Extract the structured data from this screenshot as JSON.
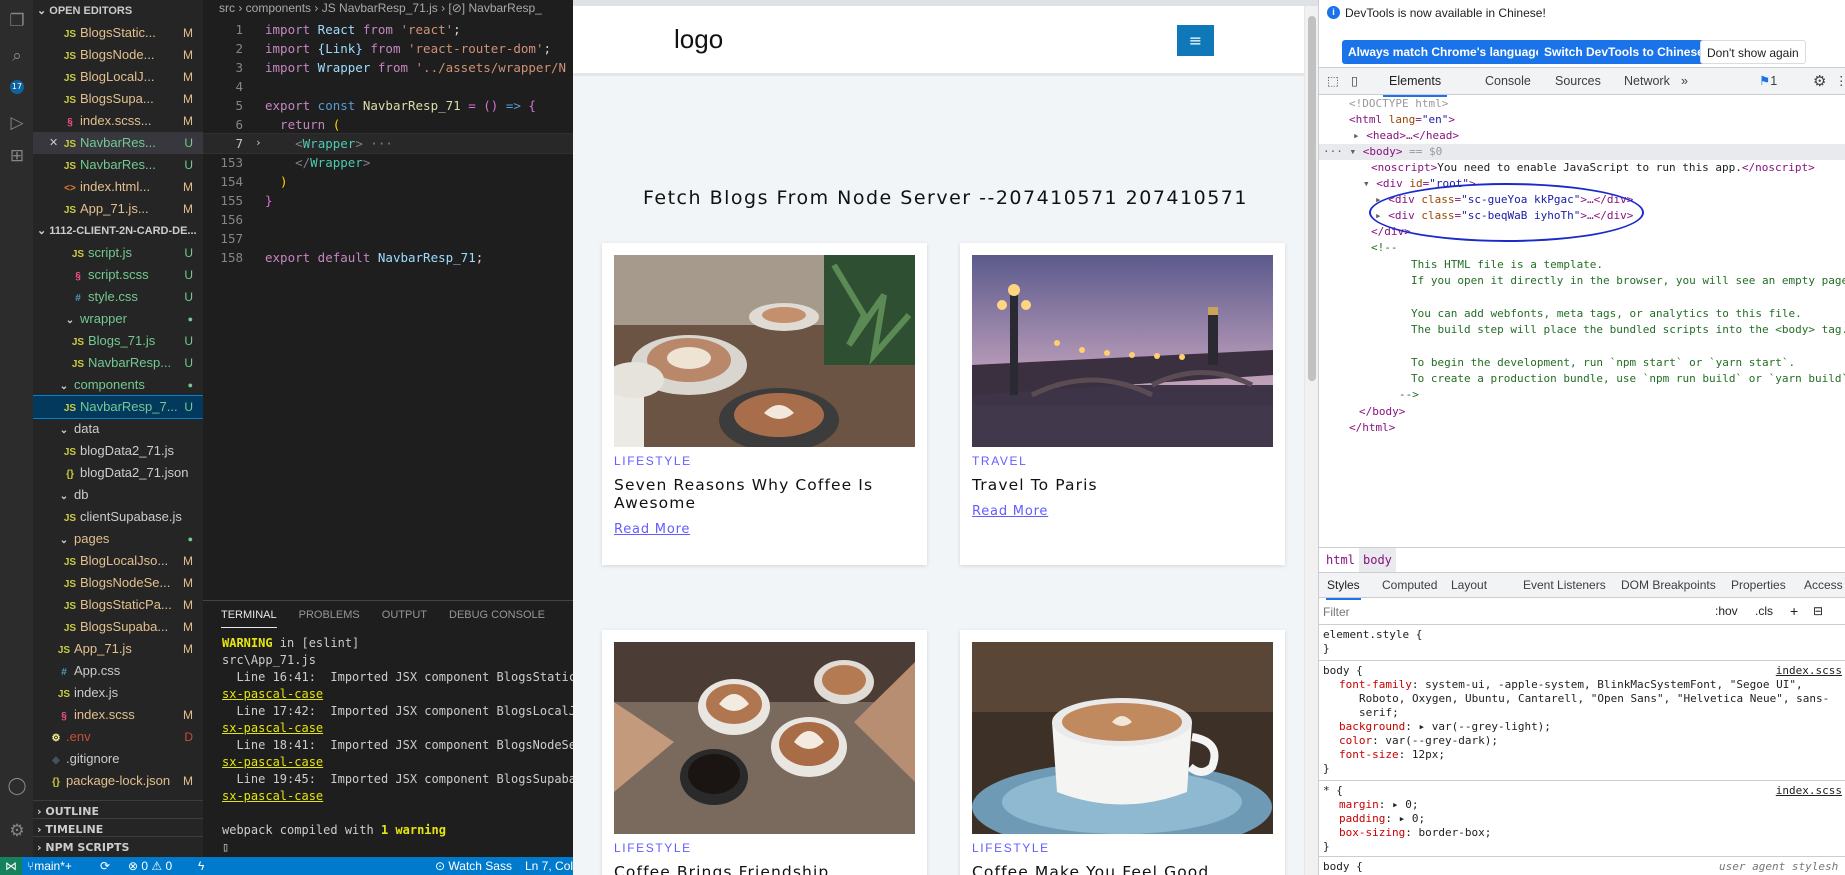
{
  "vscode": {
    "scm_badge": "17",
    "sidebar": {
      "open_editors_header": "OPEN EDITORS",
      "open_editors": [
        {
          "icon": "JS",
          "name": "BlogsStatic...",
          "status": "M",
          "kind": "js"
        },
        {
          "icon": "JS",
          "name": "BlogsNode...",
          "status": "M",
          "kind": "js"
        },
        {
          "icon": "JS",
          "name": "BlogLocalJ...",
          "status": "M",
          "kind": "js"
        },
        {
          "icon": "JS",
          "name": "BlogsSupa...",
          "status": "M",
          "kind": "js"
        },
        {
          "icon": "§",
          "name": "index.scss...",
          "status": "M",
          "kind": "scss"
        },
        {
          "icon": "JS",
          "name": "NavbarRes...",
          "status": "U",
          "kind": "js"
        },
        {
          "icon": "JS",
          "name": "NavbarRes...",
          "status": "U",
          "kind": "js"
        },
        {
          "icon": "<>",
          "name": "index.html...",
          "status": "M",
          "kind": "html"
        },
        {
          "icon": "JS",
          "name": "App_71.js...",
          "status": "M",
          "kind": "js"
        }
      ],
      "project_header": "1112-CLIENT-2N-CARD-DE...",
      "tree": [
        {
          "indent": 30,
          "icon": "JS",
          "name": "script.js",
          "status": "U",
          "kind": "js"
        },
        {
          "indent": 30,
          "icon": "§",
          "name": "script.scss",
          "status": "U",
          "kind": "scss"
        },
        {
          "indent": 30,
          "icon": "#",
          "name": "style.css",
          "status": "U",
          "kind": "css"
        },
        {
          "indent": 22,
          "icon": "⌄",
          "name": "wrapper",
          "status": "●",
          "kind": "folder"
        },
        {
          "indent": 30,
          "icon": "JS",
          "name": "Blogs_71.js",
          "status": "U",
          "kind": "js"
        },
        {
          "indent": 30,
          "icon": "JS",
          "name": "NavbarResp...",
          "status": "U",
          "kind": "js"
        },
        {
          "indent": 16,
          "icon": "⌄",
          "name": "components",
          "status": "●",
          "kind": "folder"
        },
        {
          "indent": 22,
          "icon": "JS",
          "name": "NavbarResp_7...",
          "status": "U",
          "kind": "js",
          "selected": true
        },
        {
          "indent": 16,
          "icon": "⌄",
          "name": "data",
          "status": "",
          "kind": "folder-plain"
        },
        {
          "indent": 22,
          "icon": "JS",
          "name": "blogData2_71.js",
          "status": "",
          "kind": "js-plain"
        },
        {
          "indent": 22,
          "icon": "{}",
          "name": "blogData2_71.json",
          "status": "",
          "kind": "json-plain"
        },
        {
          "indent": 16,
          "icon": "⌄",
          "name": "db",
          "status": "",
          "kind": "folder-plain"
        },
        {
          "indent": 22,
          "icon": "JS",
          "name": "clientSupabase.js",
          "status": "",
          "kind": "js-plain"
        },
        {
          "indent": 16,
          "icon": "⌄",
          "name": "pages",
          "status": "●",
          "kind": "folder-m"
        },
        {
          "indent": 22,
          "icon": "JS",
          "name": "BlogLocalJso...",
          "status": "M",
          "kind": "js"
        },
        {
          "indent": 22,
          "icon": "JS",
          "name": "BlogsNodeSe...",
          "status": "M",
          "kind": "js"
        },
        {
          "indent": 22,
          "icon": "JS",
          "name": "BlogsStaticPa...",
          "status": "M",
          "kind": "js"
        },
        {
          "indent": 22,
          "icon": "JS",
          "name": "BlogsSupaba...",
          "status": "M",
          "kind": "js"
        },
        {
          "indent": 16,
          "icon": "JS",
          "name": "App_71.js",
          "status": "M",
          "kind": "js"
        },
        {
          "indent": 16,
          "icon": "#",
          "name": "App.css",
          "status": "",
          "kind": "css-plain"
        },
        {
          "indent": 16,
          "icon": "JS",
          "name": "index.js",
          "status": "",
          "kind": "js-plain"
        },
        {
          "indent": 16,
          "icon": "§",
          "name": "index.scss",
          "status": "M",
          "kind": "scss"
        },
        {
          "indent": 8,
          "icon": "⚙",
          "name": ".env",
          "status": "D",
          "kind": "env"
        },
        {
          "indent": 8,
          "icon": "◆",
          "name": ".gitignore",
          "status": "",
          "kind": "git"
        },
        {
          "indent": 8,
          "icon": "{}",
          "name": "package-lock.json",
          "status": "M",
          "kind": "json"
        }
      ],
      "outline_header": "OUTLINE",
      "timeline_header": "TIMELINE",
      "npm_header": "NPM SCRIPTS"
    },
    "breadcrumb": "src  ›  components  ›   JS  NavbarResp_71.js  ›  [⊘] NavbarResp_",
    "code": [
      {
        "n": "1"
      },
      {
        "n": "2"
      },
      {
        "n": "3"
      },
      {
        "n": "4"
      },
      {
        "n": "5"
      },
      {
        "n": "6"
      },
      {
        "n": "7"
      },
      {
        "n": "153"
      },
      {
        "n": "154"
      },
      {
        "n": "155"
      },
      {
        "n": "156"
      },
      {
        "n": "157"
      },
      {
        "n": "158"
      }
    ],
    "code_text": {
      "l1_a": "import",
      "l1_b": " React ",
      "l1_c": "from",
      "l1_d": " 'react'",
      "l1_e": ";",
      "l2_a": "import",
      "l2_b": " {Link} ",
      "l2_c": "from",
      "l2_d": " 'react-router-dom'",
      "l2_e": ";",
      "l3_a": "import",
      "l3_b": " Wrapper ",
      "l3_c": "from",
      "l3_d": " '../assets/wrapper/N",
      "l5_a": "export",
      "l5_b": " const ",
      "l5_c": "NavbarResp_71",
      "l5_d": " = () ",
      "l5_e": "=>",
      "l5_f": " {",
      "l6_a": "  return",
      "l6_b": " (",
      "l7_a": "    <",
      "l7_b": "Wrapper",
      "l7_c": ">",
      "l7_d": " ···",
      "l153_a": "    </",
      "l153_b": "Wrapper",
      "l153_c": ">",
      "l154": "  )",
      "l155": "}",
      "l157_a": "export",
      "l157_b": " default",
      "l157_c": " NavbarResp_71",
      "l157_d": ";"
    },
    "terminal": {
      "tabs": [
        "TERMINAL",
        "PROBLEMS",
        "OUTPUT",
        "DEBUG CONSOLE"
      ],
      "warning_word": "WARNING",
      "warning_rest": " in [eslint]",
      "file": "src\\App_71.js",
      "lines": [
        {
          "pos": "  Line 16:41:",
          "msg": "  Imported JSX component BlogsStaticP"
        },
        {
          "pos": "  Line 17:42:",
          "msg": "  Imported JSX component BlogsLocalJs"
        },
        {
          "pos": "  Line 18:41:",
          "msg": "  Imported JSX component BlogsNodeSer"
        },
        {
          "pos": "  Line 19:45:",
          "msg": "  Imported JSX component BlogsSupabas"
        }
      ],
      "rule": "sx-pascal-case",
      "compiled_a": "webpack compiled with ",
      "compiled_b": "1 warning"
    },
    "status": {
      "branch": "main*+",
      "sync": "⟳",
      "problems": "⊗ 0 ⚠ 0",
      "bolt": "ϟ",
      "watch": "⊙ Watch Sass",
      "pos": "Ln 7, Col"
    }
  },
  "browser": {
    "logo": "logo",
    "menu_icon": "≡",
    "title": "Fetch Blogs From Node Server --207410571 207410571",
    "cards": [
      {
        "category": "LIFESTYLE",
        "title": "Seven Reasons Why Coffee Is Awesome",
        "link": "Read More"
      },
      {
        "category": "TRAVEL",
        "title": "Travel To Paris",
        "link": "Read More"
      },
      {
        "category": "LIFESTYLE",
        "title": "Coffee Brings Friendship"
      },
      {
        "category": "LIFESTYLE",
        "title": "Coffee Make You Feel Good"
      }
    ]
  },
  "devtools": {
    "notice": "DevTools is now available in Chinese!",
    "btn_match": "Always match Chrome's language",
    "btn_switch": "Switch DevTools to Chinese",
    "btn_dismiss": "Don't show again",
    "tabs": [
      "Elements",
      "Console",
      "Sources",
      "Network"
    ],
    "issues_count": "1",
    "dom": {
      "doctype": "<!DOCTYPE html>",
      "html_open_a": "<html ",
      "html_attr": "lang",
      "html_val": "\"en\"",
      "html_open_b": ">",
      "head": "<head>…</head>",
      "body_open": "<body>",
      "body_eq": " == $0",
      "noscript_open": "<noscript>",
      "noscript_text": "You need to enable JavaScript to run this app.",
      "noscript_close": "</noscript>",
      "root_open_a": "<div ",
      "root_attr": "id",
      "root_val": "\"root\"",
      "root_open_b": ">",
      "child1_a": "<div ",
      "child1_attr": "class",
      "child1_val": "\"sc-gueYoa kkPgac\"",
      "child1_b": ">…</div>",
      "child2_a": "<div ",
      "child2_attr": "class",
      "child2_val": "\"sc-beqWaB iyhoTh\"",
      "child2_b": ">…</div>",
      "div_close": "</div>",
      "cmt_open": "<!--",
      "cmt_lines": [
        "This HTML file is a template.",
        "If you open it directly in the browser, you will see an empty page",
        "",
        "You can add webfonts, meta tags, or analytics to this file.",
        "The build step will place the bundled scripts into the <body> tag.",
        "",
        "To begin the development, run `npm start` or `yarn start`.",
        "To create a production bundle, use `npm run build` or `yarn build`"
      ],
      "cmt_close": "-->",
      "body_close": "</body>",
      "html_close": "</html>"
    },
    "crumbs": [
      "html",
      "body"
    ],
    "subtabs": [
      "Styles",
      "Computed",
      "Layout",
      "Event Listeners",
      "DOM Breakpoints",
      "Properties",
      "Access"
    ],
    "filter_placeholder": "Filter",
    "hov": ":hov",
    "cls": ".cls",
    "styles": {
      "element_style": "element.style {",
      "close": "}",
      "body_sel": "body {",
      "source": "index.scss",
      "ff_name": "font-family",
      "ff_val_1": ": system-ui, -apple-system, BlinkMacSystemFont, \"Segoe UI\",",
      "ff_val_2": "Roboto, Oxygen, Ubuntu, Cantarell, \"Open Sans\", \"Helvetica Neue\", sans-",
      "ff_val_3": "serif;",
      "bg_name": "background",
      "bg_val": ": ▸ var(--grey-light);",
      "color_name": "color",
      "color_val": ": var(--grey-dark);",
      "fs_name": "font-size",
      "fs_val": ": 12px;",
      "star_sel": "* {",
      "m_name": "margin",
      "m_val": ": ▸ 0;",
      "p_name": "padding",
      "p_val": ": ▸ 0;",
      "bs_name": "box-sizing",
      "bs_val": ": border-box;",
      "body2": "body {",
      "ua": "user agent stylesh"
    }
  }
}
